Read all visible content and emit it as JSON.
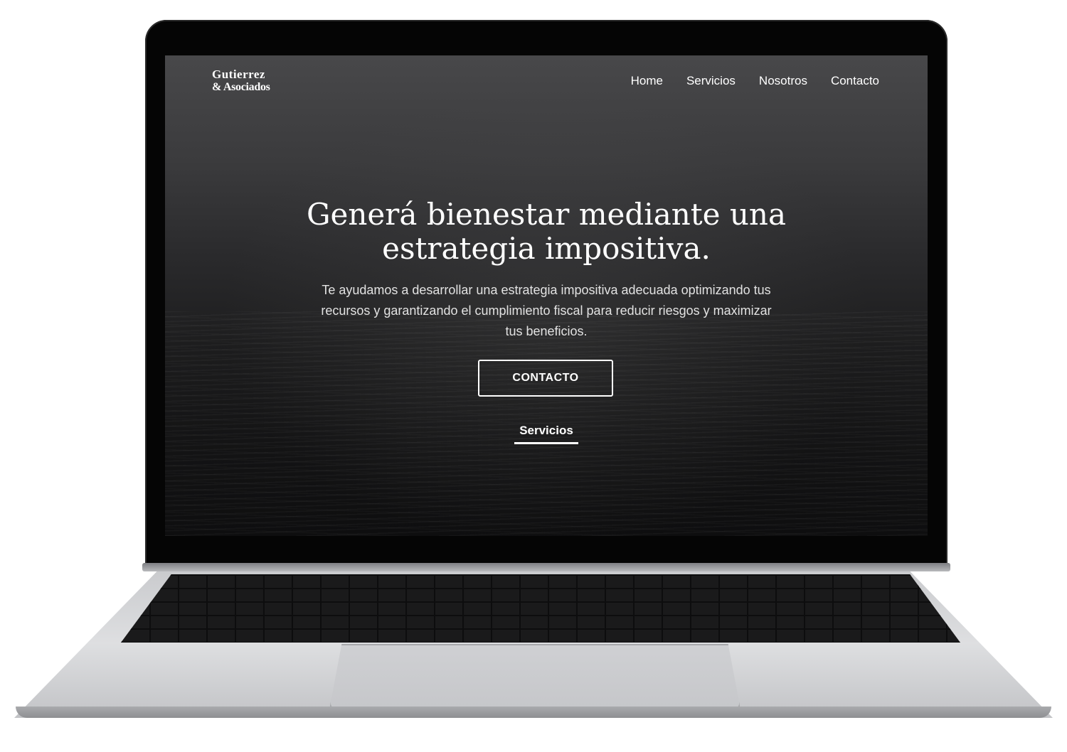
{
  "site": {
    "logo_line1": "Gutierrez",
    "logo_line2": "& Asociados"
  },
  "nav": {
    "items": [
      "Home",
      "Servicios",
      "Nosotros",
      "Contacto"
    ]
  },
  "hero": {
    "title": "Generá bienestar mediante una estrategia impositiva.",
    "subtitle": "Te ayudamos a desarrollar una estrategia impositiva adecuada optimizando tus recursos y garantizando el cumplimiento fiscal para reducir riesgos y maximizar tus beneficios.",
    "cta_label": "CONTACTO",
    "secondary_link": "Servicios"
  },
  "colors": {
    "text": "#ffffff",
    "bezel": "#050505",
    "hero_top": "#48484a",
    "hero_bottom": "#0e0e0f"
  },
  "icons": []
}
